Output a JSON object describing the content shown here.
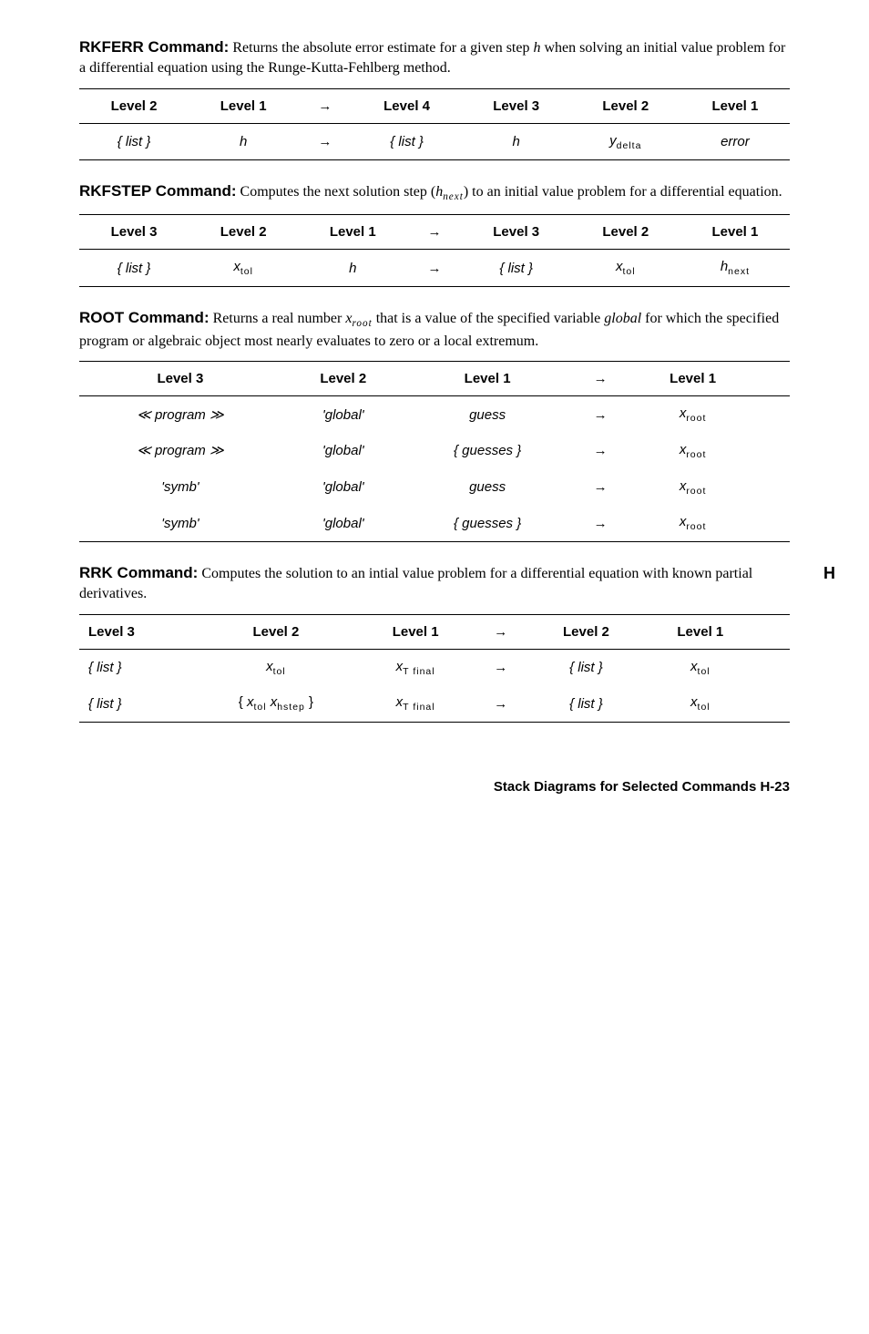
{
  "rkferr": {
    "heading": "RKFERR Command:",
    "desc": "Returns the absolute error estimate for a given step h when solving an initial value problem for a differential equation using the Runge-Kutta-Fehlberg method.",
    "headers": [
      "Level 2",
      "Level 1",
      "→",
      "Level 4",
      "Level 3",
      "Level 2",
      "Level 1"
    ],
    "row": [
      "{ list }",
      "h",
      "→",
      "{ list }",
      "h",
      "ydelta",
      "error"
    ]
  },
  "rkfstep": {
    "heading": "RKFSTEP Command:",
    "desc": "Computes the next solution step (hnext) to an initial value problem for a differential equation.",
    "headers": [
      "Level 3",
      "Level 2",
      "Level 1",
      "→",
      "Level 3",
      "Level 2",
      "Level 1"
    ],
    "row": [
      "{ list }",
      "xtol",
      "h",
      "→",
      "{ list }",
      "xtol",
      "hnext"
    ]
  },
  "root": {
    "heading": "ROOT Command:",
    "desc": "Returns a real number xroot that is a value of the specified variable global for which the specified program or algebraic object most nearly evaluates to zero or a local extremum.",
    "headers": [
      "Level 3",
      "Level 2",
      "Level 1",
      "→",
      "Level 1"
    ],
    "rows": [
      [
        "≪ program ≫",
        "'global'",
        "guess",
        "→",
        "xroot"
      ],
      [
        "≪ program ≫",
        "'global'",
        "{ guesses }",
        "→",
        "xroot"
      ],
      [
        "'symb'",
        "'global'",
        "guess",
        "→",
        "xroot"
      ],
      [
        "'symb'",
        "'global'",
        "{ guesses }",
        "→",
        "xroot"
      ]
    ]
  },
  "rrk": {
    "heading": "RRK Command:",
    "desc": "Computes the solution to an intial value problem for a differential equation with known partial derivatives.",
    "headers": [
      "Level 3",
      "Level 2",
      "Level 1",
      "→",
      "Level 2",
      "Level 1"
    ],
    "rows": [
      [
        "{ list }",
        "xtol",
        "xTfinal",
        "→",
        "{ list }",
        "xtol"
      ],
      [
        "{ list }",
        "{ xtol xhstep }",
        "xTfinal",
        "→",
        "{ list }",
        "xtol"
      ]
    ]
  },
  "margin_letter": "H",
  "footer": "Stack Diagrams for Selected Commands   H-23"
}
